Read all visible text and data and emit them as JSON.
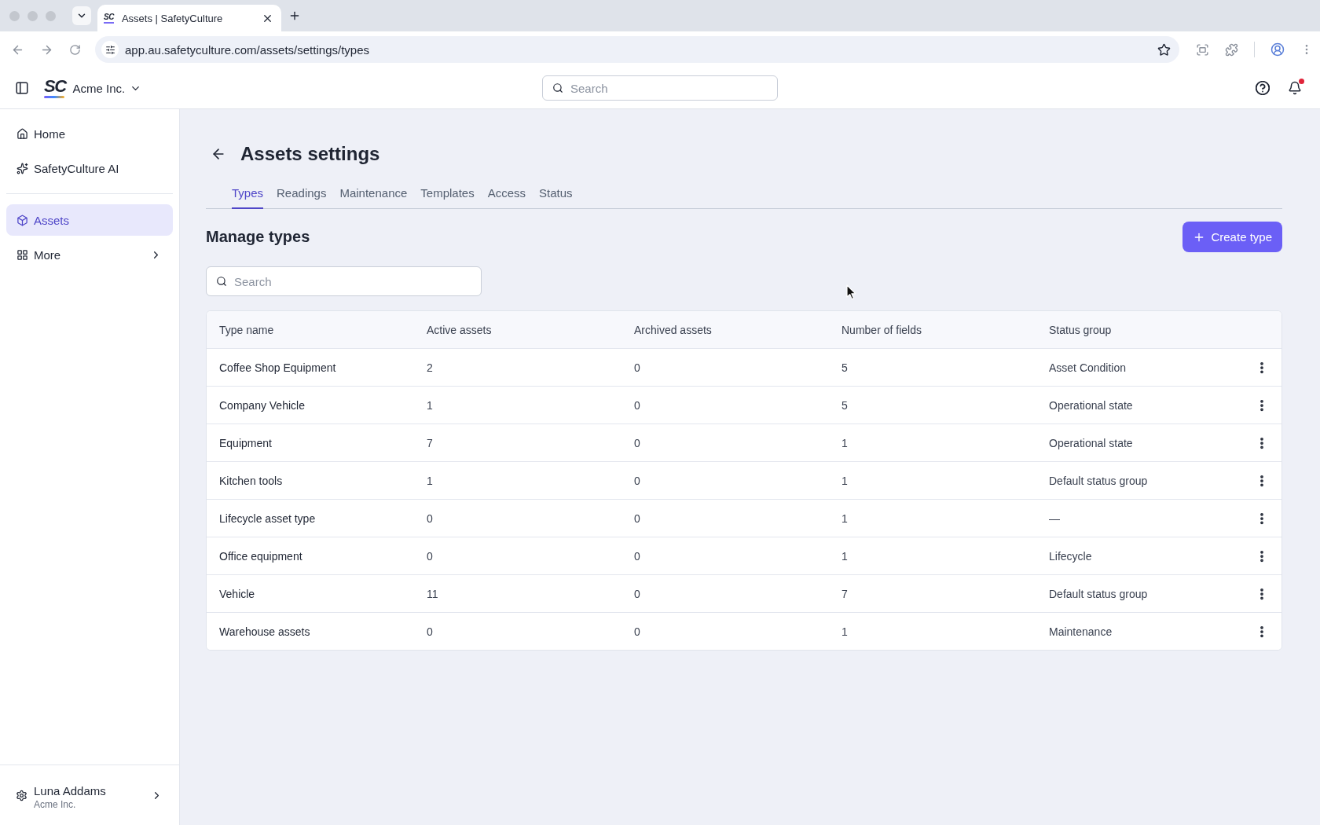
{
  "browser": {
    "tab": {
      "favicon": "SC",
      "title": "Assets | SafetyCulture"
    },
    "url": "app.au.safetyculture.com/assets/settings/types"
  },
  "header": {
    "logo": "SC",
    "organization": "Acme Inc.",
    "search": {
      "placeholder": "Search"
    },
    "notifications": {
      "unread": true
    }
  },
  "sidebar": {
    "sections": [
      {
        "items": [
          {
            "label": "Home",
            "selected": false,
            "has_submenu": false
          },
          {
            "label": "SafetyCulture AI",
            "selected": false,
            "has_submenu": false
          }
        ]
      },
      {
        "items": [
          {
            "label": "Assets",
            "selected": true,
            "has_submenu": false
          },
          {
            "label": "More",
            "selected": false,
            "has_submenu": true
          }
        ]
      }
    ],
    "user": {
      "name": "Luna Addams",
      "organization": "Acme Inc."
    }
  },
  "page": {
    "title": "Assets settings",
    "tabs": [
      {
        "label": "Types",
        "selected": true
      },
      {
        "label": "Readings",
        "selected": false
      },
      {
        "label": "Maintenance",
        "selected": false
      },
      {
        "label": "Templates",
        "selected": false
      },
      {
        "label": "Access",
        "selected": false
      },
      {
        "label": "Status",
        "selected": false
      }
    ],
    "section_title": "Manage types",
    "create_button": "Create type",
    "search": {
      "placeholder": "Search"
    }
  },
  "table": {
    "columns": [
      "Type name",
      "Active assets",
      "Archived assets",
      "Number of fields",
      "Status group"
    ],
    "rows": [
      {
        "cells": [
          "Coffee Shop Equipment",
          "2",
          "0",
          "5",
          "Asset Condition"
        ]
      },
      {
        "cells": [
          "Company Vehicle",
          "1",
          "0",
          "5",
          "Operational state"
        ]
      },
      {
        "cells": [
          "Equipment",
          "7",
          "0",
          "1",
          "Operational state"
        ]
      },
      {
        "cells": [
          "Kitchen tools",
          "1",
          "0",
          "1",
          "Default status group"
        ]
      },
      {
        "cells": [
          "Lifecycle asset type",
          "0",
          "0",
          "1",
          "—"
        ]
      },
      {
        "cells": [
          "Office equipment",
          "0",
          "0",
          "1",
          "Lifecycle"
        ]
      },
      {
        "cells": [
          "Vehicle",
          "11",
          "0",
          "7",
          "Default status group"
        ]
      },
      {
        "cells": [
          "Warehouse assets",
          "0",
          "0",
          "1",
          "Maintenance"
        ]
      }
    ]
  }
}
